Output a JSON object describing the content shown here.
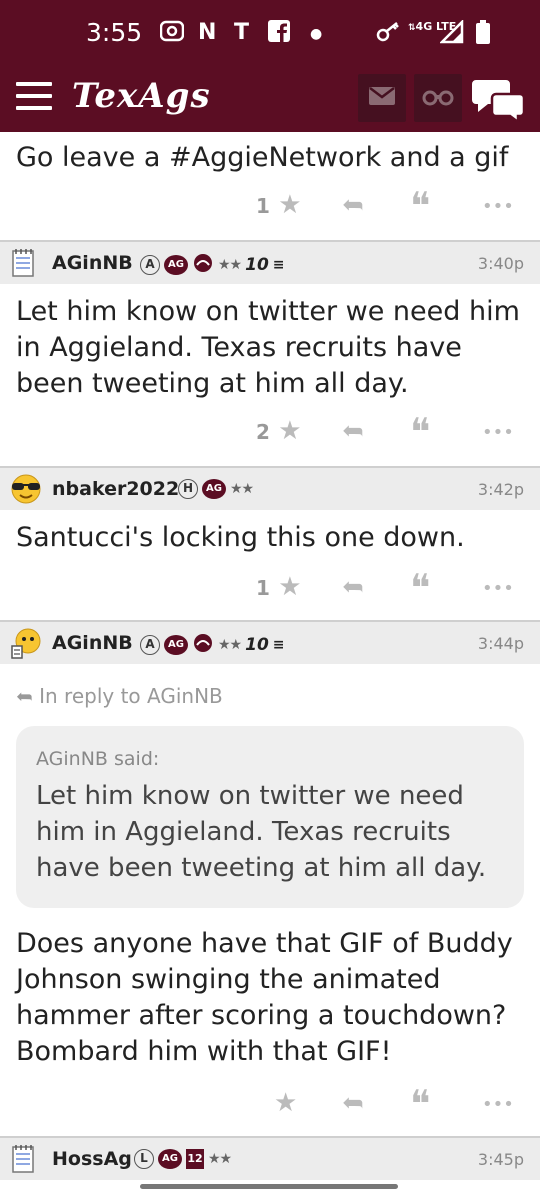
{
  "status_bar": {
    "time": "3:55",
    "left_icons": [
      "record-icon",
      "netflix-icon",
      "t-icon",
      "facebook-icon",
      "dot-icon"
    ],
    "network": "4G LTE"
  },
  "app": {
    "title": "TexAgs",
    "brand_color": "#5b0d23"
  },
  "posts": [
    {
      "text": "Go leave a #AggieNetwork and a gif",
      "star_count": "1"
    },
    {
      "username": "AGinNB",
      "badges": [
        "A",
        "AG"
      ],
      "stars": "★★",
      "rank_badge": "10",
      "timestamp": "3:40p",
      "text": "Let him know on twitter we need him in Aggieland. Texas recruits have been tweeting at him all day.",
      "star_count": "2"
    },
    {
      "username": "nbaker2022",
      "badges": [
        "H",
        "AG"
      ],
      "stars": "★★",
      "timestamp": "3:42p",
      "text": "Santucci's locking this one down.",
      "star_count": "1"
    },
    {
      "username": "AGinNB",
      "badges": [
        "A",
        "AG"
      ],
      "stars": "★★",
      "rank_badge": "10",
      "timestamp": "3:44p",
      "reply_to": "In reply to AGinNB",
      "quote_author": "AGinNB said:",
      "quote_text": "Let him know on twitter we need him in Aggieland. Texas recruits have been tweeting at him all day.",
      "text": "Does anyone have that GIF of Buddy Johnson swinging the animated hammer after scoring a touchdown? Bombard him with that GIF!",
      "star_count": ""
    },
    {
      "username": "HossAg",
      "badges": [
        "L",
        "AG",
        "12"
      ],
      "stars": "★★",
      "timestamp": "3:45p"
    }
  ],
  "actions": {
    "star": "★",
    "reply": "➦",
    "quote": "❝",
    "more": "•••"
  }
}
